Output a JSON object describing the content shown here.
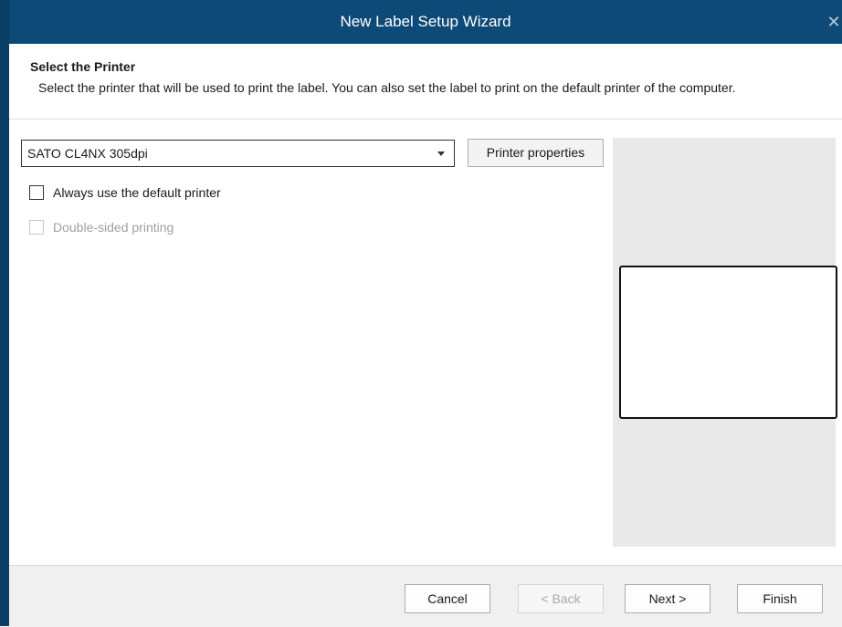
{
  "window": {
    "title": "New Label Setup Wizard",
    "close_glyph": "✕"
  },
  "header": {
    "title": "Select the Printer",
    "description": "Select the printer that will be used to print the label. You can also set the label to print on the default printer of the computer."
  },
  "printer": {
    "selected": "SATO CL4NX 305dpi",
    "properties_button": "Printer properties"
  },
  "options": {
    "always_default": {
      "label": "Always use the default printer",
      "checked": false
    },
    "double_sided": {
      "label": "Double-sided printing",
      "checked": false,
      "enabled": false
    }
  },
  "footer": {
    "cancel": "Cancel",
    "back": "< Back",
    "next": "Next >",
    "finish": "Finish"
  },
  "icons": {
    "close": "close-icon",
    "dropdown": "chevron-down-icon"
  },
  "colors": {
    "titlebar": "#0e4a78",
    "accent_edge": "#0b3e66",
    "preview_background": "#e9e9e9"
  }
}
